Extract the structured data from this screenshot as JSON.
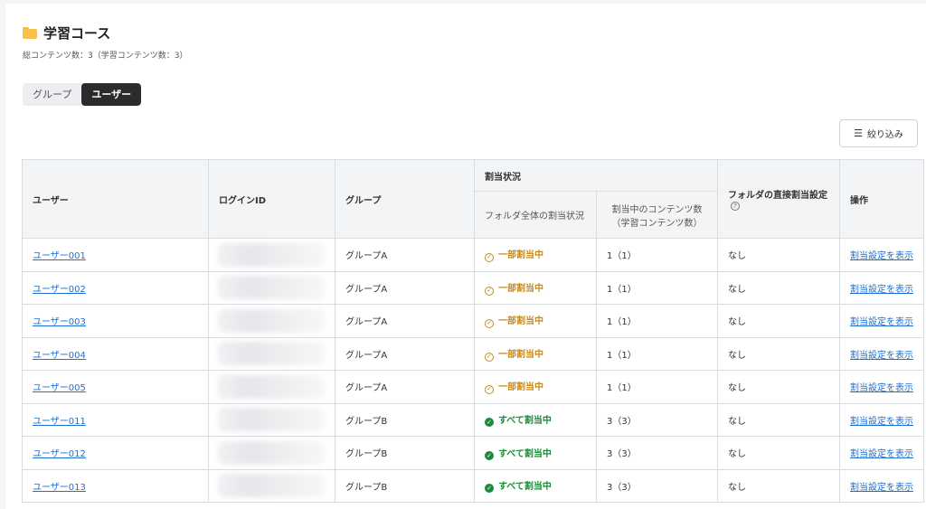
{
  "header": {
    "title": "学習コース",
    "subtitle": "総コンテンツ数：3（学習コンテンツ数：3）"
  },
  "view_toggle": {
    "group_label": "グループ",
    "user_label": "ユーザー",
    "selected": "ユーザー"
  },
  "filter": {
    "label": "絞り込み"
  },
  "table": {
    "headers": {
      "user": "ユーザー",
      "login_id": "ログインID",
      "group": "グループ",
      "assign_status": "割当状況",
      "folder_status": "フォルダ全体の割当状況",
      "content_count_line1": "割当中のコンテンツ数",
      "content_count_line2": "（学習コンテンツ数）",
      "direct_assign": "フォルダの直接割当設定",
      "action": "操作"
    },
    "rows": [
      {
        "user": "ユーザー001",
        "group": "グループA",
        "status": "一部割当中",
        "count": "1（1）",
        "direct": "なし",
        "action": "割当設定を表示"
      },
      {
        "user": "ユーザー002",
        "group": "グループA",
        "status": "一部割当中",
        "count": "1（1）",
        "direct": "なし",
        "action": "割当設定を表示"
      },
      {
        "user": "ユーザー003",
        "group": "グループA",
        "status": "一部割当中",
        "count": "1（1）",
        "direct": "なし",
        "action": "割当設定を表示"
      },
      {
        "user": "ユーザー004",
        "group": "グループA",
        "status": "一部割当中",
        "count": "1（1）",
        "direct": "なし",
        "action": "割当設定を表示"
      },
      {
        "user": "ユーザー005",
        "group": "グループA",
        "status": "一部割当中",
        "count": "1（1）",
        "direct": "なし",
        "action": "割当設定を表示"
      },
      {
        "user": "ユーザー011",
        "group": "グループB",
        "status": "すべて割当中",
        "count": "3（3）",
        "direct": "なし",
        "action": "割当設定を表示"
      },
      {
        "user": "ユーザー012",
        "group": "グループB",
        "status": "すべて割当中",
        "count": "3（3）",
        "direct": "なし",
        "action": "割当設定を表示"
      },
      {
        "user": "ユーザー013",
        "group": "グループB",
        "status": "すべて割当中",
        "count": "3（3）",
        "direct": "なし",
        "action": "割当設定を表示"
      }
    ]
  },
  "colors": {
    "partial": "#c98a1b",
    "all": "#1d8a3a",
    "link": "#1f6fd0",
    "folder": "#f7c14c"
  },
  "icons": {
    "folder": "folder-icon",
    "filter": "filter-icon",
    "partial": "clock-check-icon",
    "all": "check-circle-icon",
    "help": "help-icon"
  }
}
